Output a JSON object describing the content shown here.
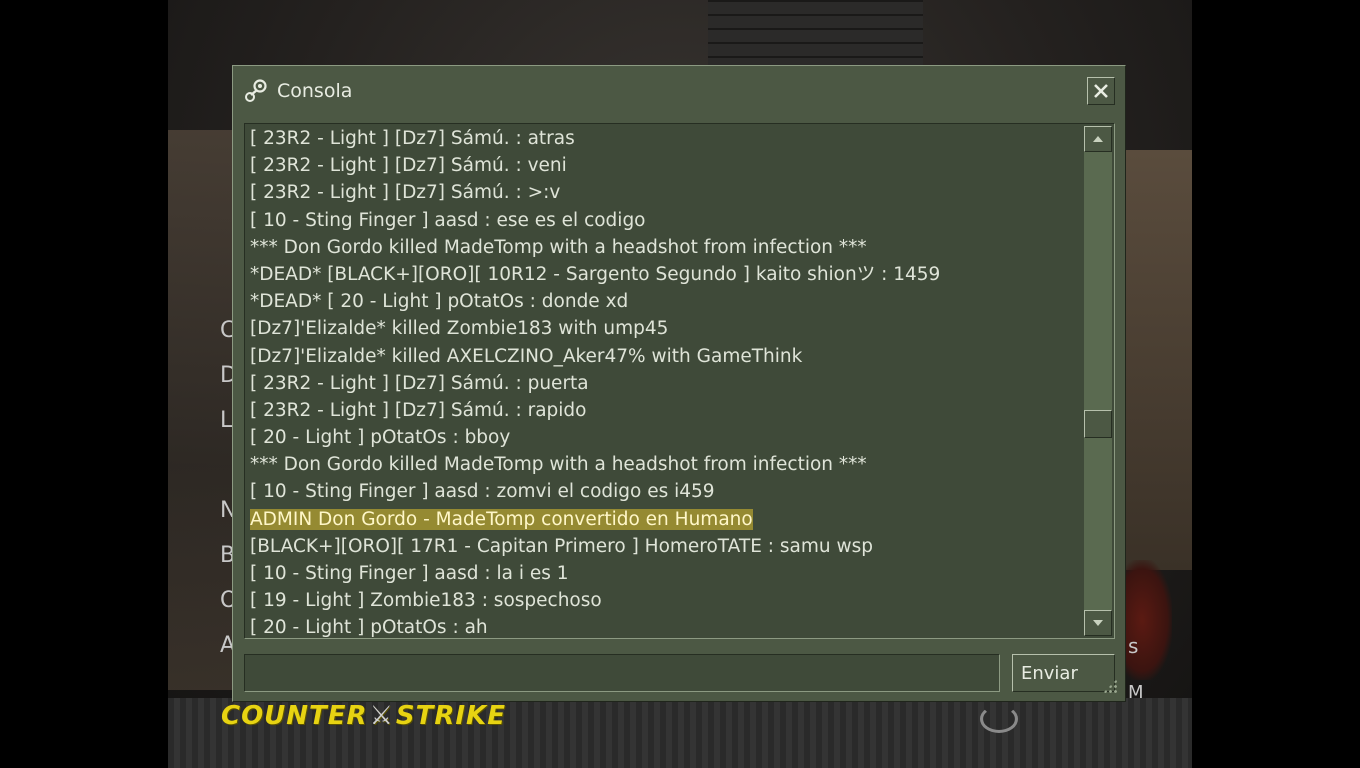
{
  "background": {
    "menu_letters": [
      "C",
      "D",
      "L",
      "N",
      "B",
      "O",
      "A"
    ],
    "status_right": [
      "s",
      "M"
    ],
    "logo": {
      "left": "COUNTER",
      "right": "STRIKE"
    },
    "colors": {
      "logo": "#e7d312"
    }
  },
  "console": {
    "title": "Consola",
    "icon": "steam-icon",
    "close_icon": "close-icon",
    "lines": [
      "[ 23R2 - Light ] [Dz7] Sámú. : atras",
      "[ 23R2 - Light ] [Dz7] Sámú. : veni",
      "[ 23R2 - Light ] [Dz7] Sámú. : >:v",
      "[ 10 - Sting Finger ] aasd : ese es el codigo",
      "*** Don Gordo killed MadeTomp with a headshot from infection ***",
      "*DEAD* [BLACK+][ORO][ 10R12 - Sargento Segundo ] kaito shionツ : 1459",
      "*DEAD* [ 20 - Light ] pOtatOs : donde xd",
      "[Dz7]'Elizalde* killed Zombie183 with ump45",
      "[Dz7]'Elizalde* killed AXELCZINO_Aker47% with GameThink",
      "[ 23R2 - Light ] [Dz7] Sámú. : puerta",
      "[ 23R2 - Light ] [Dz7] Sámú. : rapido",
      "[ 20 - Light ] pOtatOs : bboy",
      "*** Don Gordo killed MadeTomp with a headshot from infection ***",
      "[ 10 - Sting Finger ] aasd : zomvi el codigo es i459",
      "ADMIN Don Gordo - MadeTomp convertido en Humano",
      "[BLACK+][ORO][ 17R1 - Capitan Primero ] HomeroTATE : samu wsp",
      "[ 10 - Sting Finger ] aasd : la i es 1",
      "[ 19 - Light ] Zombie183 : sospechoso",
      "[ 20 - Light ] pOtatOs : ah"
    ],
    "highlighted_line_index": 14,
    "input_value": "",
    "send_label": "Enviar",
    "scroll_position": 0.6,
    "colors": {
      "window": "#4c5844",
      "log_bg": "#3f4a39",
      "highlight": "#958a32",
      "text": "#dfe4d8"
    }
  }
}
